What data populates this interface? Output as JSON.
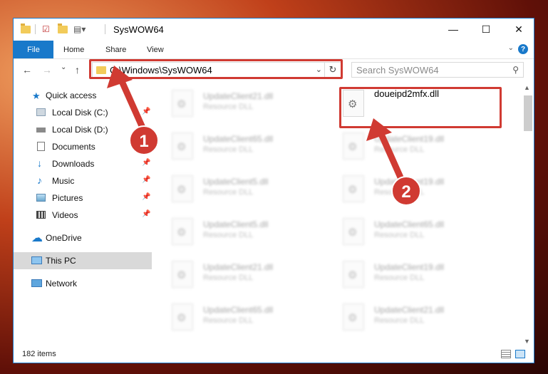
{
  "window": {
    "title": "SysWOW64",
    "controls": {
      "minimize": "—",
      "maximize": "☐",
      "close": "✕"
    }
  },
  "ribbon": {
    "tabs": [
      {
        "label": "File"
      },
      {
        "label": "Home"
      },
      {
        "label": "Share"
      },
      {
        "label": "View"
      }
    ],
    "help": "?"
  },
  "nav": {
    "back": "←",
    "forward": "→",
    "recent": "⌄",
    "up": "↑",
    "address": "C:\\Windows\\SysWOW64",
    "refresh": "↻",
    "search_placeholder": "Search SysWOW64"
  },
  "sidebar": {
    "items": [
      {
        "label": "Quick access",
        "pinned": false
      },
      {
        "label": "Local Disk (C:)",
        "pinned": true
      },
      {
        "label": "Local Disk (D:)",
        "pinned": false
      },
      {
        "label": "Documents",
        "pinned": true
      },
      {
        "label": "Downloads",
        "pinned": true
      },
      {
        "label": "Music",
        "pinned": true
      },
      {
        "label": "Pictures",
        "pinned": true
      },
      {
        "label": "Videos",
        "pinned": true
      },
      {
        "label": "OneDrive",
        "pinned": false
      },
      {
        "label": "This PC",
        "pinned": false,
        "selected": true
      },
      {
        "label": "Network",
        "pinned": false
      }
    ]
  },
  "files": {
    "highlighted": {
      "name": "doueipd2mfx.dll"
    },
    "blurred": [
      {
        "name": "UpdateClient21.dll",
        "type": "Resource DLL"
      },
      {
        "name": "UpdateClient65.dll",
        "type": "Resource DLL"
      },
      {
        "name": "UpdateClient19.dll",
        "type": "Resource DLL"
      },
      {
        "name": "UpdateClient5.dll",
        "type": "Resource DLL"
      },
      {
        "name": "UpdateClient19.dll",
        "type": "Resource DLL"
      },
      {
        "name": "UpdateClient5.dll",
        "type": "Resource DLL"
      },
      {
        "name": "UpdateClient65.dll",
        "type": "Resource DLL"
      },
      {
        "name": "UpdateClient21.dll",
        "type": "Resource DLL"
      },
      {
        "name": "UpdateClient19.dll",
        "type": "Resource DLL"
      },
      {
        "name": "UpdateClient65.dll",
        "type": "Resource DLL"
      },
      {
        "name": "UpdateClient21.dll",
        "type": "Resource DLL"
      }
    ]
  },
  "status": {
    "count": "182 items"
  },
  "annotations": {
    "step1": "1",
    "step2": "2",
    "color": "#d03a32"
  }
}
